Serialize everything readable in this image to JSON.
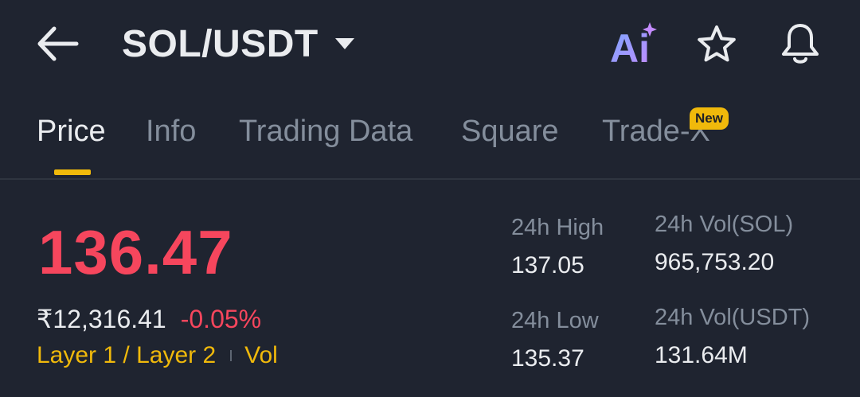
{
  "header": {
    "pair": "SOL/USDT",
    "ai_label": "Ai"
  },
  "tabs": [
    {
      "label": "Price",
      "active": true
    },
    {
      "label": "Info"
    },
    {
      "label": "Trading Data"
    },
    {
      "label": "Square"
    },
    {
      "label": "Trade-X",
      "badge": "New"
    }
  ],
  "price": {
    "last": "136.47",
    "fiat": "₹12,316.41",
    "change": "-0.05%",
    "tags": [
      "Layer 1 / Layer 2",
      "Vol"
    ]
  },
  "stats": {
    "high_label": "24h High",
    "high_value": "137.05",
    "low_label": "24h Low",
    "low_value": "135.37",
    "vol_base_label": "24h Vol(SOL)",
    "vol_base_value": "965,753.20",
    "vol_quote_label": "24h Vol(USDT)",
    "vol_quote_value": "131.64M"
  },
  "colors": {
    "background": "#1f2430",
    "price_down": "#f6465d",
    "accent_yellow": "#f0b90b",
    "muted_text": "#848e9c"
  }
}
